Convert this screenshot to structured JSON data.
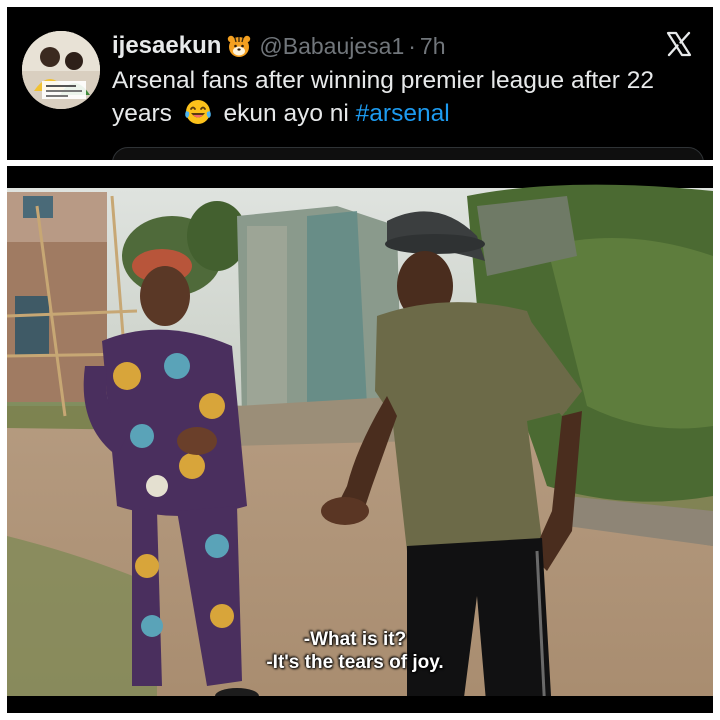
{
  "tweet": {
    "display_name": "ijesaekun",
    "name_emoji": "tiger-face-icon",
    "handle": "@Babaujesa1",
    "separator": "·",
    "time": "7h",
    "text_main": "Arsenal fans after winning premier league after 22 years",
    "text_emoji": "laughing-tears-emoji",
    "text_after": "ekun ayo ni",
    "hashtag": "#arsenal",
    "platform_icon": "x-logo-icon",
    "colors": {
      "background": "#000000",
      "text": "#e7e9ea",
      "muted": "#71767b",
      "link": "#1d9bf0"
    }
  },
  "video": {
    "subtitle_line1": "-What is it?",
    "subtitle_line2": "-It's the tears of joy."
  }
}
